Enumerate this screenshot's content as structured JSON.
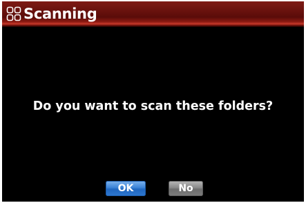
{
  "dialog": {
    "title": "Scanning",
    "title_icon": "grid-icon",
    "message": "Do you want to scan these folders?",
    "buttons": {
      "ok_label": "OK",
      "no_label": "No"
    }
  },
  "colors": {
    "screen_background": "#000000",
    "title_bar": "#6a120e",
    "title_bar_highlight": "#c7392a",
    "text": "#ffffff",
    "ok_button": "#2f78cf",
    "no_button": "#7d7d7d"
  }
}
